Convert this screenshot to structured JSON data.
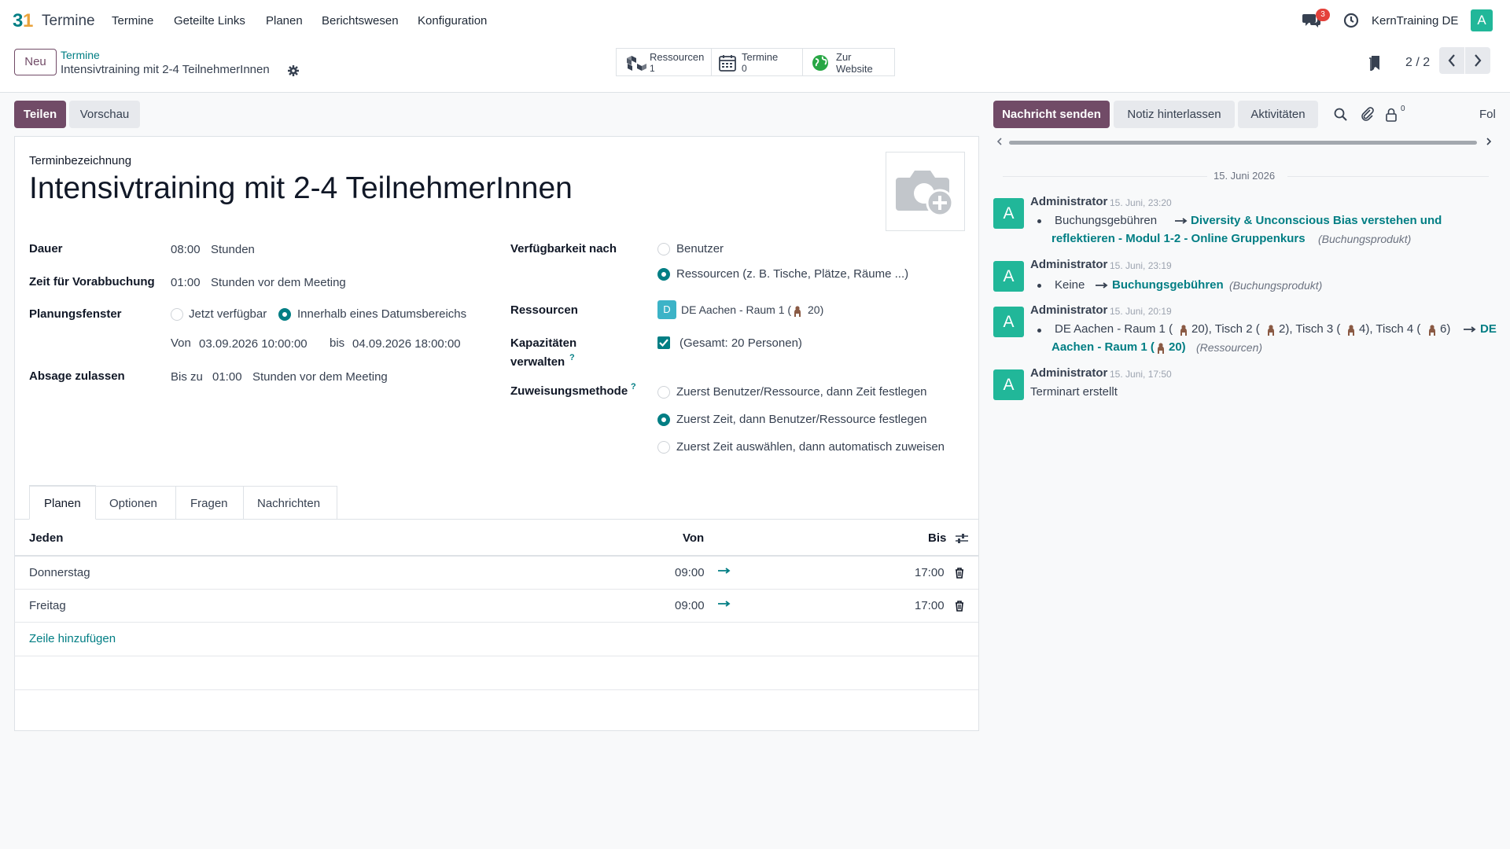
{
  "app": {
    "name": "Termine",
    "menu": [
      "Termine",
      "Geteilte Links",
      "Planen",
      "Berichtswesen",
      "Konfiguration"
    ],
    "chat_count": "3",
    "company": "KernTraining DE",
    "avatar_letter": "A"
  },
  "control": {
    "new_label": "Neu",
    "breadcrumb_parent": "Termine",
    "breadcrumb_current": "Intensivtraining mit 2-4 TeilnehmerInnen",
    "pager": "2 / 2",
    "smart_buttons": [
      {
        "label": "Ressourcen",
        "value": "1"
      },
      {
        "label": "Termine",
        "value": "0"
      },
      {
        "label": "Zur",
        "label2": "Website"
      }
    ]
  },
  "actions": {
    "share": "Teilen",
    "preview": "Vorschau"
  },
  "form": {
    "name_label": "Terminbezeichnung",
    "title": "Intensivtraining mit 2-4 TeilnehmerInnen",
    "duration_label": "Dauer",
    "duration_value": "08:00",
    "duration_unit": "Stunden",
    "prebook_label": "Zeit für Vorabbuchung",
    "prebook_value": "01:00",
    "prebook_unit": "Stunden vor dem Meeting",
    "window_label": "Planungsfenster",
    "window_opt1": "Jetzt verfügbar",
    "window_opt2": "Innerhalb eines Datumsbereichs",
    "from_label": "Von",
    "from_value": "03.09.2026 10:00:00",
    "to_label": "bis",
    "to_value": "04.09.2026 18:00:00",
    "cancel_label": "Absage zulassen",
    "cancel_prefix": "Bis zu",
    "cancel_value": "01:00",
    "cancel_unit": "Stunden vor dem Meeting",
    "avail_label": "Verfügbarkeit nach",
    "avail_opt1": "Benutzer",
    "avail_opt2": "Ressourcen (z. B. Tische, Plätze, Räume ...)",
    "resources_label": "Ressourcen",
    "resource_badge": "D",
    "resource_value": "DE Aachen - Raum 1 (",
    "resource_capacity": "20)",
    "capacity_label1": "Kapazitäten",
    "capacity_label2": "verwalten",
    "capacity_value": "(Gesamt: 20 Personen)",
    "assign_label": "Zuweisungsmethode",
    "assign_opt1": "Zuerst Benutzer/Ressource, dann Zeit festlegen",
    "assign_opt2": "Zuerst Zeit, dann Benutzer/Ressource festlegen",
    "assign_opt3": "Zuerst Zeit auswählen, dann automatisch zuweisen",
    "help_mark": "?"
  },
  "tabs": [
    "Planen",
    "Optionen",
    "Fragen",
    "Nachrichten"
  ],
  "schedule": {
    "headers": {
      "every": "Jeden",
      "from": "Von",
      "to": "Bis"
    },
    "rows": [
      {
        "day": "Donnerstag",
        "from": "09:00",
        "to": "17:00"
      },
      {
        "day": "Freitag",
        "from": "09:00",
        "to": "17:00"
      }
    ],
    "add_line": "Zeile hinzufügen"
  },
  "chatter": {
    "send": "Nachricht senden",
    "note": "Notiz hinterlassen",
    "activities": "Aktivitäten",
    "followers_count": "0",
    "follow": "Fol",
    "date_sep": "15. Juni 2026",
    "messages": [
      {
        "author": "Administrator",
        "time": "15. Juni, 23:20",
        "old": "Buchungsgebühren",
        "new": "Diversity & Unconscious Bias verstehen und",
        "new2": "reflektieren - Modul 1-2 - Online Gruppenkurs",
        "field": "(Buchungsprodukt)"
      },
      {
        "author": "Administrator",
        "time": "15. Juni, 23:19",
        "old": "Keine",
        "new": "Buchungsgebühren",
        "field": "(Buchungsprodukt)"
      },
      {
        "author": "Administrator",
        "time": "15. Juni, 20:19",
        "old": "DE Aachen - Raum 1 (",
        "old_b": "20), Tisch 2 (",
        "old_c": "2), Tisch 3 (",
        "old_d": "4), Tisch 4 (",
        "old_e": "6)",
        "new": "DE",
        "new2": "Aachen - Raum 1 (",
        "new2b": "20)",
        "field": "(Ressourcen)"
      },
      {
        "author": "Administrator",
        "time": "15. Juni, 17:50",
        "body": "Terminart erstellt"
      }
    ]
  },
  "colors": {
    "brand": "#714b67",
    "accent": "#017e84",
    "avatar": "#21b799"
  }
}
